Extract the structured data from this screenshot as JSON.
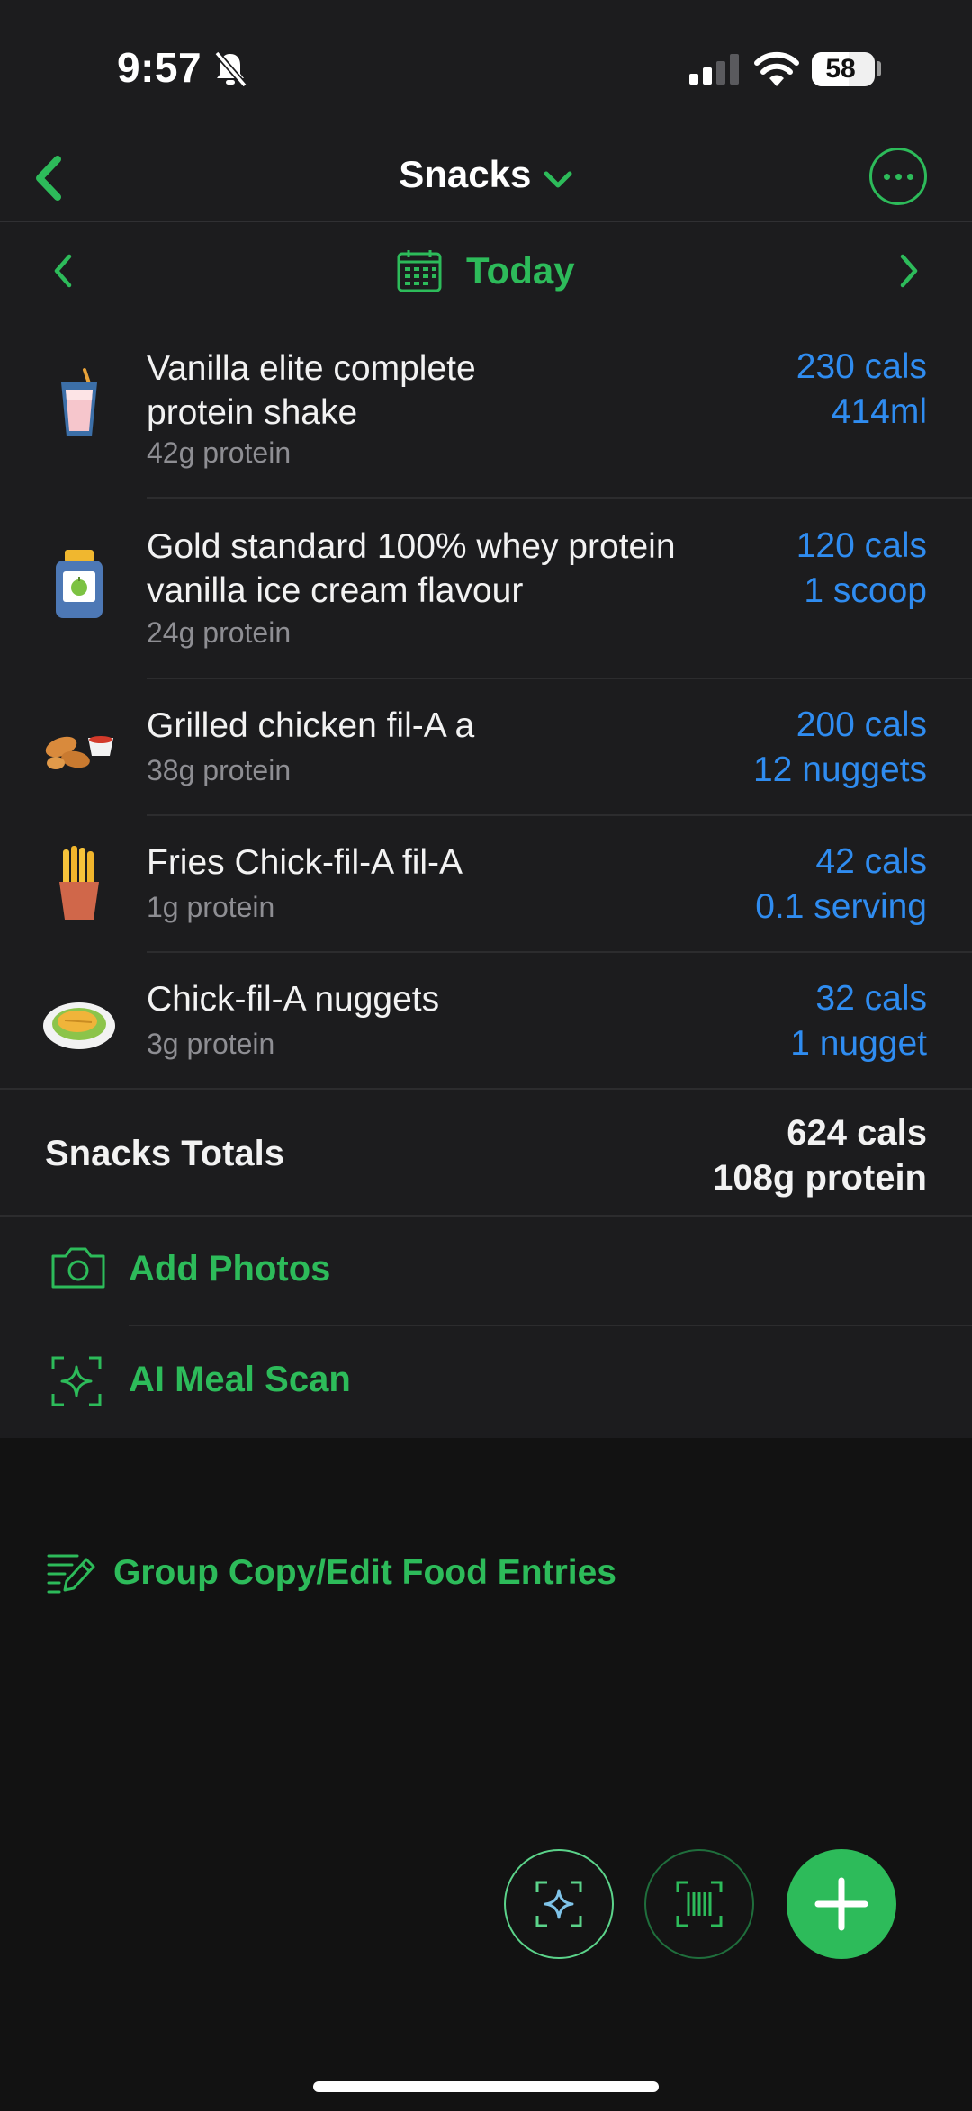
{
  "status_bar": {
    "time": "9:57",
    "battery": "58",
    "icons": [
      "bell-slash-icon",
      "signal-icon",
      "wifi-icon",
      "battery-icon"
    ]
  },
  "nav": {
    "title": "Snacks",
    "back_icon": "chevron-left-icon",
    "title_icon": "chevron-down-icon",
    "more_icon": "ellipsis-circle-icon"
  },
  "date_bar": {
    "label": "Today",
    "icon": "calendar-icon"
  },
  "foods": [
    {
      "name_line1": "Vanilla elite complete",
      "name_line2": "protein shake",
      "protein": "42g protein",
      "cals": "230 cals",
      "amount": "414ml",
      "icon": "protein-shake-icon"
    },
    {
      "name_line1": "Gold standard 100% whey protein",
      "name_line2": "vanilla ice cream flavour",
      "protein": "24g protein",
      "cals": "120 cals",
      "amount": "1 scoop",
      "icon": "protein-jar-icon"
    },
    {
      "name_line1": "Grilled chicken fil-A a",
      "name_line2": "",
      "protein": "38g protein",
      "cals": "200 cals",
      "amount": "12 nuggets",
      "icon": "chicken-nuggets-icon"
    },
    {
      "name_line1": "Fries Chick-fil-A fil-A",
      "name_line2": "",
      "protein": "1g protein",
      "cals": "42 cals",
      "amount": "0.1 serving",
      "icon": "fries-icon"
    },
    {
      "name_line1": "Chick-fil-A nuggets",
      "name_line2": "",
      "protein": "3g protein",
      "cals": "32 cals",
      "amount": "1 nugget",
      "icon": "plate-food-icon"
    }
  ],
  "totals": {
    "label": "Snacks Totals",
    "cals": "624 cals",
    "protein": "108g protein"
  },
  "actions": {
    "add_photos": "Add Photos",
    "ai_meal_scan": "AI Meal Scan"
  },
  "group_edit": {
    "label": "Group Copy/Edit Food Entries",
    "icon": "edit-list-icon"
  },
  "fabs": [
    "ai-scan-icon",
    "barcode-icon",
    "plus-icon"
  ],
  "colors": {
    "accent_green": "#2dbb5a",
    "value_blue": "#2f8cf0",
    "surface": "#1c1c1e",
    "background": "#121212"
  }
}
